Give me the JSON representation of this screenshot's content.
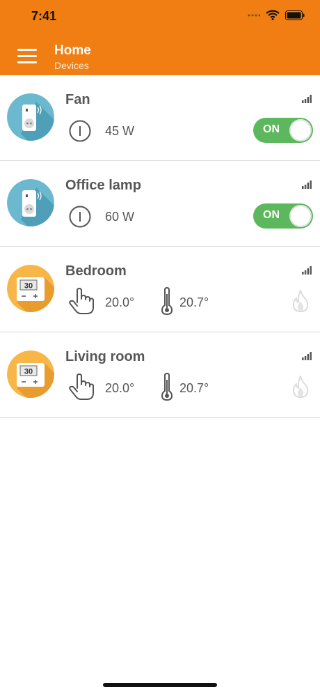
{
  "status_bar": {
    "time": "7:41"
  },
  "header": {
    "title": "Home",
    "subtitle": "Devices"
  },
  "devices": [
    {
      "name": "Fan",
      "type": "plug",
      "power": "45 W",
      "toggle": "ON"
    },
    {
      "name": "Office lamp",
      "type": "plug",
      "power": "60 W",
      "toggle": "ON"
    },
    {
      "name": "Bedroom",
      "type": "thermostat",
      "set_temp": "20.0°",
      "current_temp": "20.7°"
    },
    {
      "name": "Living room",
      "type": "thermostat",
      "set_temp": "20.0°",
      "current_temp": "20.7°"
    }
  ],
  "colors": {
    "accent": "#f07e12",
    "toggle_on": "#5cb85c",
    "plug_icon_bg": "#6bb8cf",
    "thermostat_icon_bg": "#f9b648"
  },
  "icons": [
    "menu-icon",
    "wifi-icon",
    "battery-icon",
    "signal-icon",
    "power-icon",
    "hand-icon",
    "thermometer-icon",
    "flame-icon"
  ]
}
